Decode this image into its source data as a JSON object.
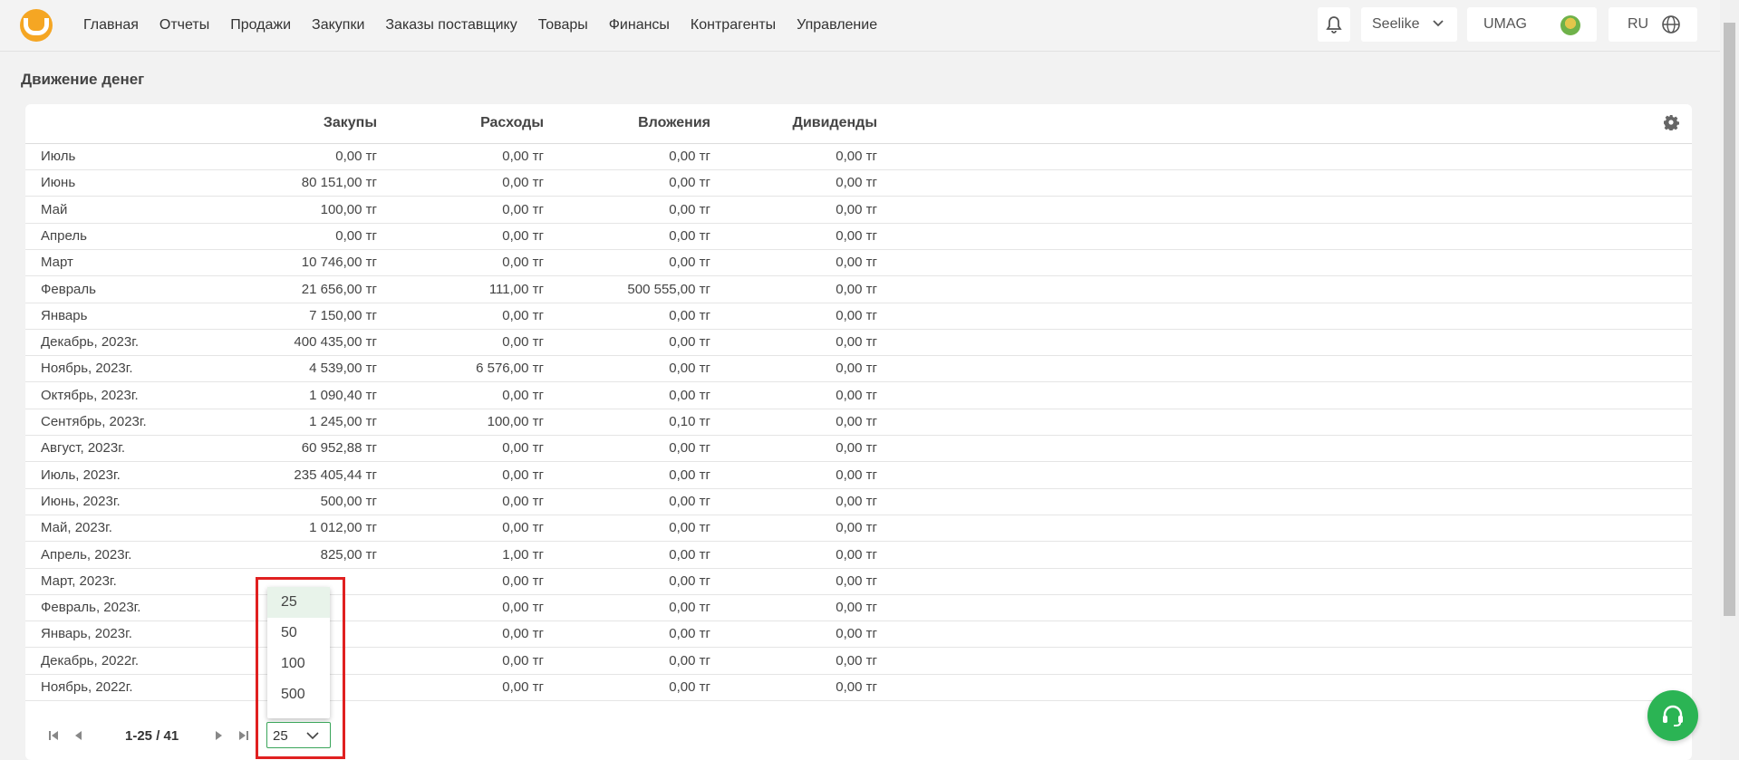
{
  "nav": {
    "items": [
      "Главная",
      "Отчеты",
      "Продажи",
      "Закупки",
      "Заказы поставщику",
      "Товары",
      "Финансы",
      "Контрагенты",
      "Управление"
    ]
  },
  "header": {
    "store": "Seelike",
    "company": "UMAG",
    "lang": "RU"
  },
  "page": {
    "title": "Движение денег"
  },
  "table": {
    "columns": [
      "Закупы",
      "Расходы",
      "Вложения",
      "Дивиденды"
    ],
    "rows": [
      [
        "Июль",
        "0,00 тг",
        "0,00 тг",
        "0,00 тг",
        "0,00 тг"
      ],
      [
        "Июнь",
        "80 151,00 тг",
        "0,00 тг",
        "0,00 тг",
        "0,00 тг"
      ],
      [
        "Май",
        "100,00 тг",
        "0,00 тг",
        "0,00 тг",
        "0,00 тг"
      ],
      [
        "Апрель",
        "0,00 тг",
        "0,00 тг",
        "0,00 тг",
        "0,00 тг"
      ],
      [
        "Март",
        "10 746,00 тг",
        "0,00 тг",
        "0,00 тг",
        "0,00 тг"
      ],
      [
        "Февраль",
        "21 656,00 тг",
        "111,00 тг",
        "500 555,00 тг",
        "0,00 тг"
      ],
      [
        "Январь",
        "7 150,00 тг",
        "0,00 тг",
        "0,00 тг",
        "0,00 тг"
      ],
      [
        "Декабрь, 2023г.",
        "400 435,00 тг",
        "0,00 тг",
        "0,00 тг",
        "0,00 тг"
      ],
      [
        "Ноябрь, 2023г.",
        "4 539,00 тг",
        "6 576,00 тг",
        "0,00 тг",
        "0,00 тг"
      ],
      [
        "Октябрь, 2023г.",
        "1 090,40 тг",
        "0,00 тг",
        "0,00 тг",
        "0,00 тг"
      ],
      [
        "Сентябрь, 2023г.",
        "1 245,00 тг",
        "100,00 тг",
        "0,10 тг",
        "0,00 тг"
      ],
      [
        "Август, 2023г.",
        "60 952,88 тг",
        "0,00 тг",
        "0,00 тг",
        "0,00 тг"
      ],
      [
        "Июль, 2023г.",
        "235 405,44 тг",
        "0,00 тг",
        "0,00 тг",
        "0,00 тг"
      ],
      [
        "Июнь, 2023г.",
        "500,00 тг",
        "0,00 тг",
        "0,00 тг",
        "0,00 тг"
      ],
      [
        "Май, 2023г.",
        "1 012,00 тг",
        "0,00 тг",
        "0,00 тг",
        "0,00 тг"
      ],
      [
        "Апрель, 2023г.",
        "825,00 тг",
        "1,00 тг",
        "0,00 тг",
        "0,00 тг"
      ],
      [
        "Март, 2023г.",
        "",
        "0,00 тг",
        "0,00 тг",
        "0,00 тг"
      ],
      [
        "Февраль, 2023г.",
        "",
        "0,00 тг",
        "0,00 тг",
        "0,00 тг"
      ],
      [
        "Январь, 2023г.",
        "",
        "0,00 тг",
        "0,00 тг",
        "0,00 тг"
      ],
      [
        "Декабрь, 2022г.",
        "",
        "0,00 тг",
        "0,00 тг",
        "0,00 тг"
      ],
      [
        "Ноябрь, 2022г.",
        "",
        "0,00 тг",
        "0,00 тг",
        "0,00 тг"
      ]
    ]
  },
  "pager": {
    "range": "1-25 / 41",
    "page_size": "25",
    "options": [
      "25",
      "50",
      "100",
      "500"
    ]
  }
}
